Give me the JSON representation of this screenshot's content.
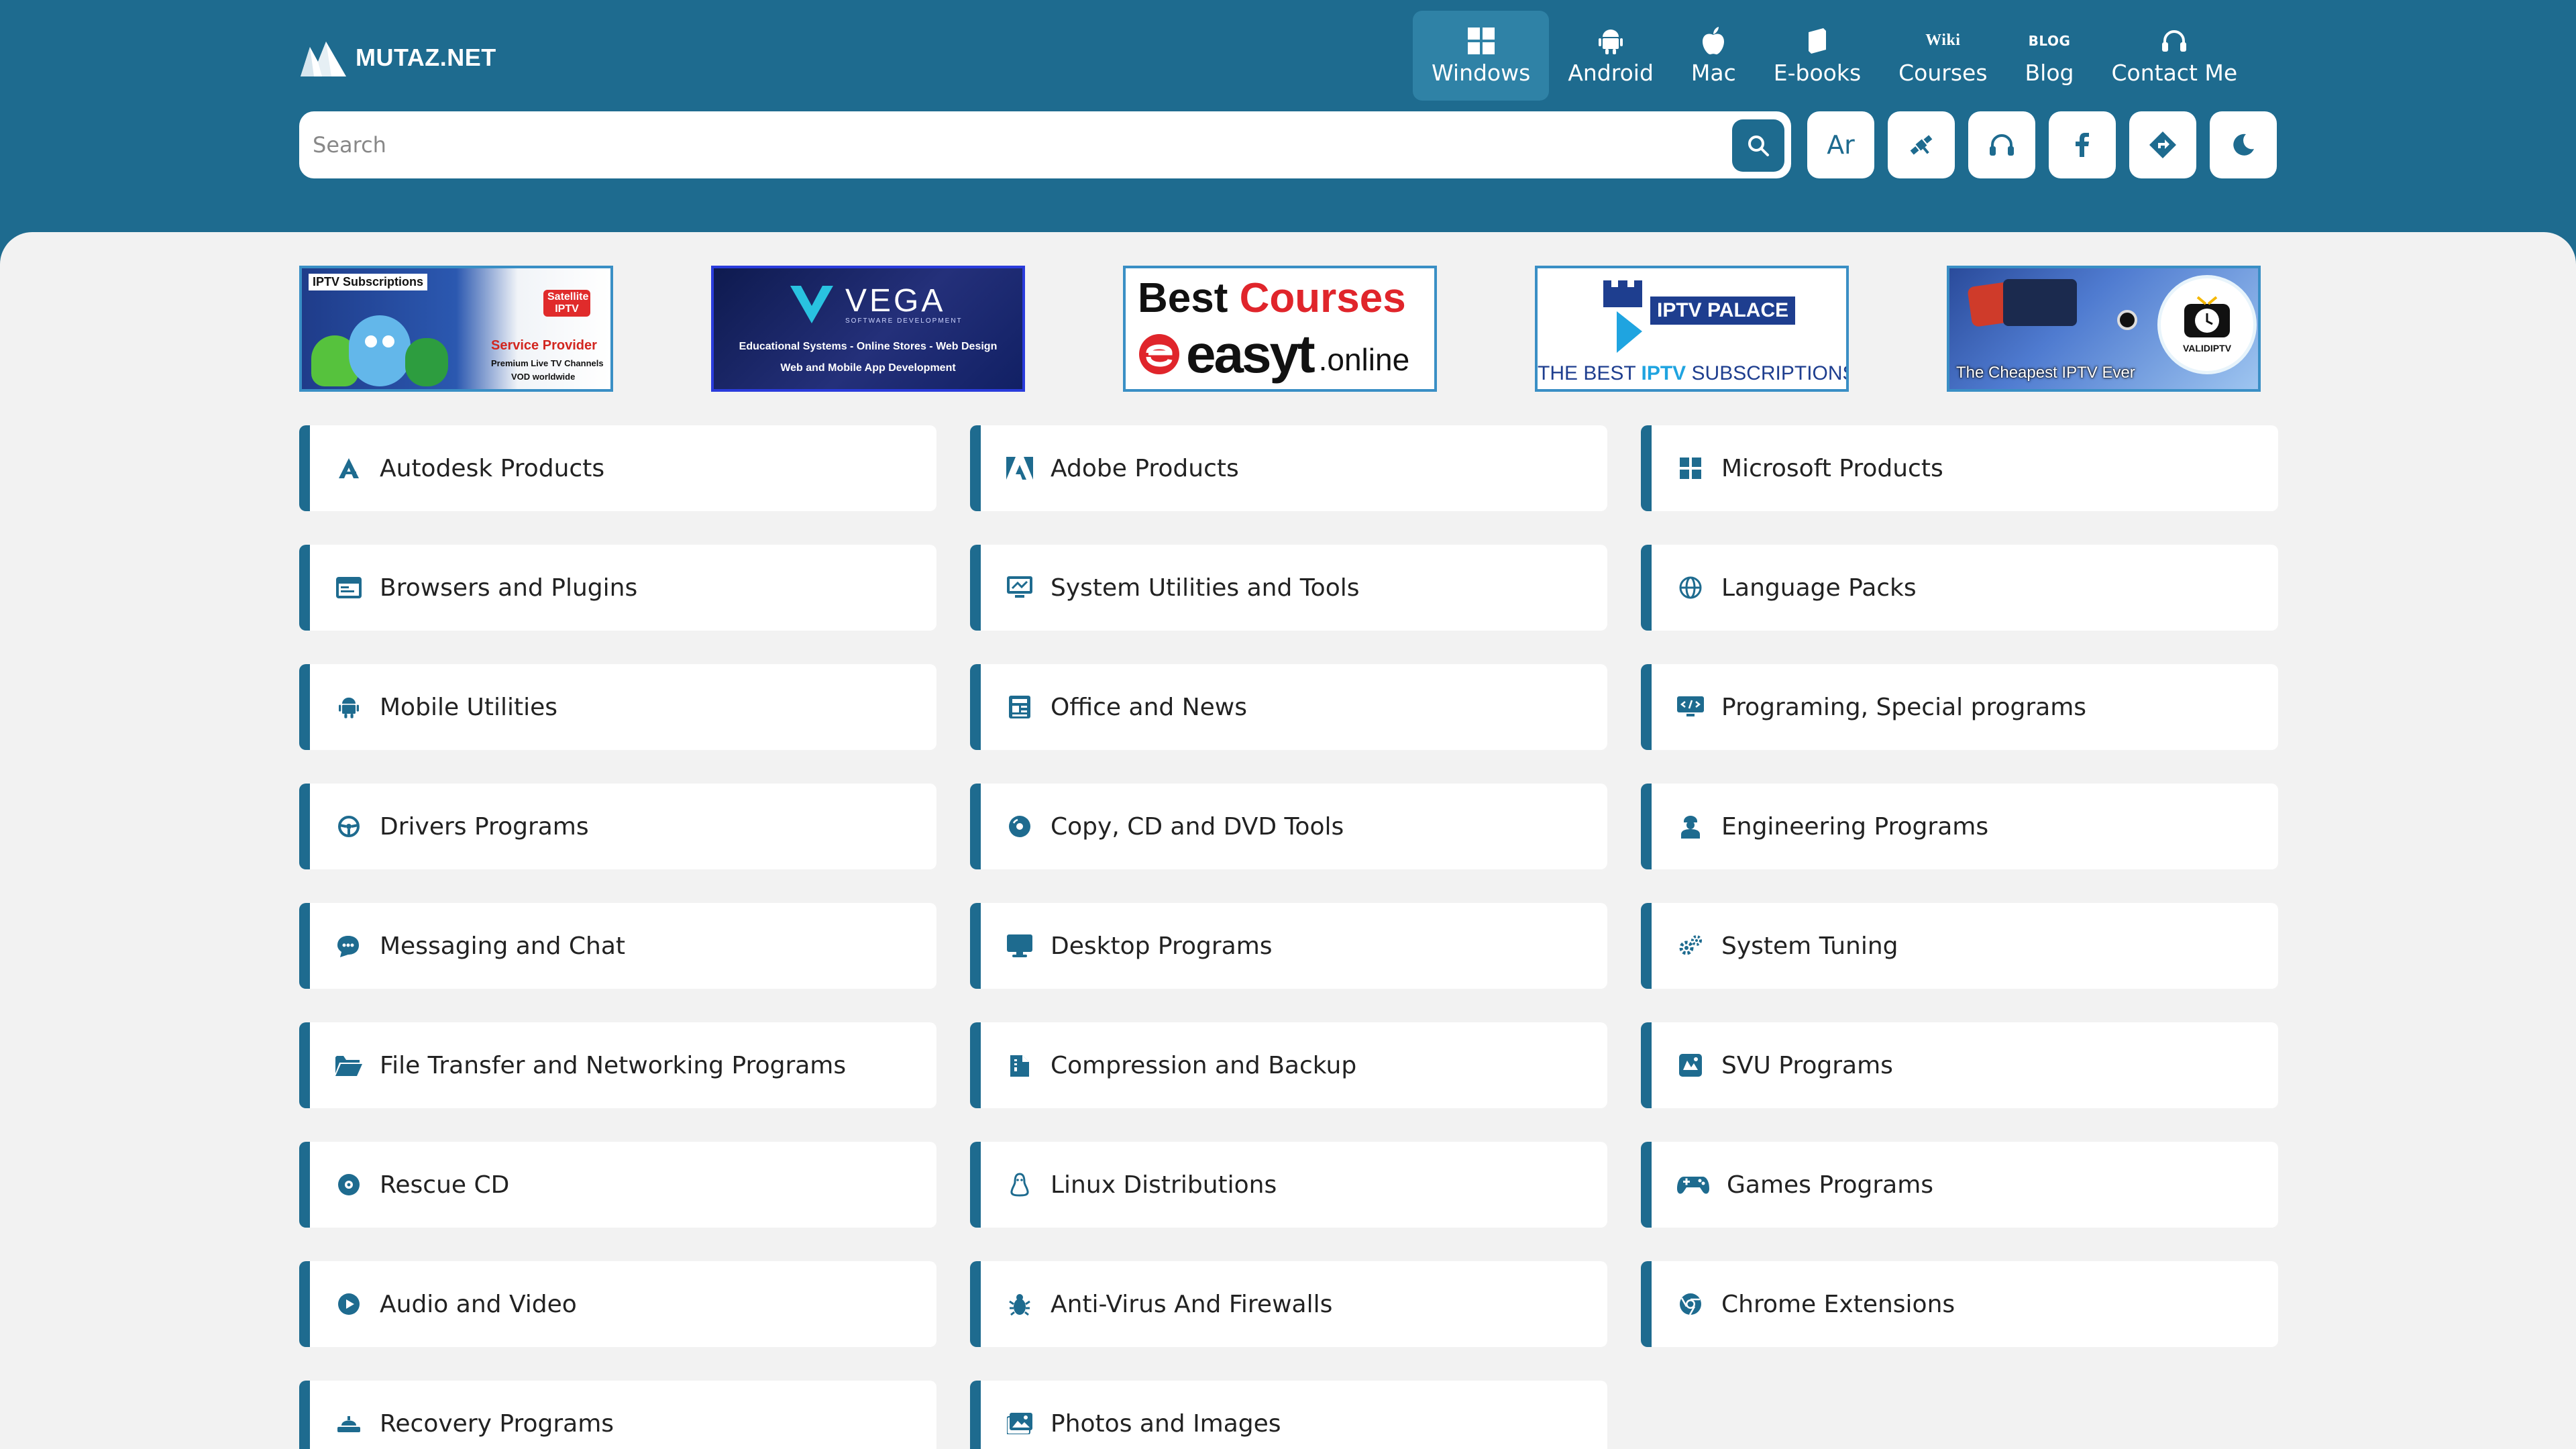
{
  "brand": {
    "logo_text": "MUTAZ.NET"
  },
  "nav": [
    {
      "label": "Windows",
      "icon": "windows-icon",
      "active": true
    },
    {
      "label": "Android",
      "icon": "android-icon"
    },
    {
      "label": "Mac",
      "icon": "apple-icon"
    },
    {
      "label": "E-books",
      "icon": "book-icon"
    },
    {
      "label": "Courses",
      "icon": "wiki-icon",
      "icon_text": "Wiki"
    },
    {
      "label": "Blog",
      "icon": "blog-icon",
      "icon_text": "BLOG"
    },
    {
      "label": "Contact Me",
      "icon": "headset-icon"
    }
  ],
  "search": {
    "placeholder": "Search"
  },
  "actions": [
    {
      "name": "arabic-language-button",
      "text": "Ar"
    },
    {
      "name": "satellite-icon"
    },
    {
      "name": "headset-icon"
    },
    {
      "name": "facebook-icon"
    },
    {
      "name": "diamond-direction-icon"
    },
    {
      "name": "dark-mode-moon-icon"
    }
  ],
  "banners": [
    {
      "name": "iptv-subscriptions-banner",
      "top_text": "IPTV Subscriptions",
      "badge": "Satellite IPTV",
      "headline": "Service Provider",
      "sub": "Premium Live TV Channels",
      "sub2": "VOD worldwide"
    },
    {
      "name": "vega-banner",
      "brand": "VEGA",
      "tagline": "SOFTWARE DEVELOPMENT",
      "line1": "Educational Systems - Online Stores - Web Design",
      "line2": "Web and Mobile App Development"
    },
    {
      "name": "easyt-banner",
      "line1a": "Best",
      "line1b": "Courses",
      "logo": "easyt",
      "logo_suffix": ".online"
    },
    {
      "name": "iptv-palace-banner",
      "brand": "IPTV PALACE",
      "line_a": "THE BEST",
      "line_b": "IPTV",
      "line_c": "SUBSCRIPTIONS"
    },
    {
      "name": "validiptv-banner",
      "caption": "The Cheapest IPTV Ever",
      "badge": "VALIDIPTV"
    }
  ],
  "categories": [
    {
      "label": "Autodesk Products",
      "icon": "autodesk-icon"
    },
    {
      "label": "Adobe Products",
      "icon": "adobe-icon"
    },
    {
      "label": "Microsoft Products",
      "icon": "windows-icon"
    },
    {
      "label": "Browsers and Plugins",
      "icon": "browser-icon"
    },
    {
      "label": "System Utilities and Tools",
      "icon": "monitor-tools-icon"
    },
    {
      "label": "Language Packs",
      "icon": "globe-icon"
    },
    {
      "label": "Mobile Utilities",
      "icon": "android-icon"
    },
    {
      "label": "Office and News",
      "icon": "newspaper-icon"
    },
    {
      "label": "Programing, Special programs",
      "icon": "code-monitor-icon"
    },
    {
      "label": "Drivers Programs",
      "icon": "steering-wheel-icon"
    },
    {
      "label": "Copy, CD and DVD Tools",
      "icon": "disc-icon"
    },
    {
      "label": "Engineering Programs",
      "icon": "engineer-icon"
    },
    {
      "label": "Messaging and Chat",
      "icon": "chat-icon"
    },
    {
      "label": "Desktop Programs",
      "icon": "desktop-icon"
    },
    {
      "label": "System Tuning",
      "icon": "gears-icon"
    },
    {
      "label": "File Transfer and Networking Programs",
      "icon": "folder-open-icon"
    },
    {
      "label": "Compression and Backup",
      "icon": "file-zip-icon"
    },
    {
      "label": "SVU Programs",
      "icon": "svu-icon"
    },
    {
      "label": "Rescue CD",
      "icon": "compact-disc-icon"
    },
    {
      "label": "Linux Distributions",
      "icon": "linux-icon"
    },
    {
      "label": "Games Programs",
      "icon": "gamepad-icon"
    },
    {
      "label": "Audio and Video",
      "icon": "play-circle-icon"
    },
    {
      "label": "Anti-Virus And Firewalls",
      "icon": "bug-icon"
    },
    {
      "label": "Chrome Extensions",
      "icon": "chrome-icon"
    },
    {
      "label": "Recovery Programs",
      "icon": "recovery-icon"
    },
    {
      "label": "Photos and Images",
      "icon": "image-icon"
    }
  ],
  "colors": {
    "primary": "#1e6b8f",
    "active_nav": "#2f82a6",
    "background": "#f2f2f2"
  }
}
